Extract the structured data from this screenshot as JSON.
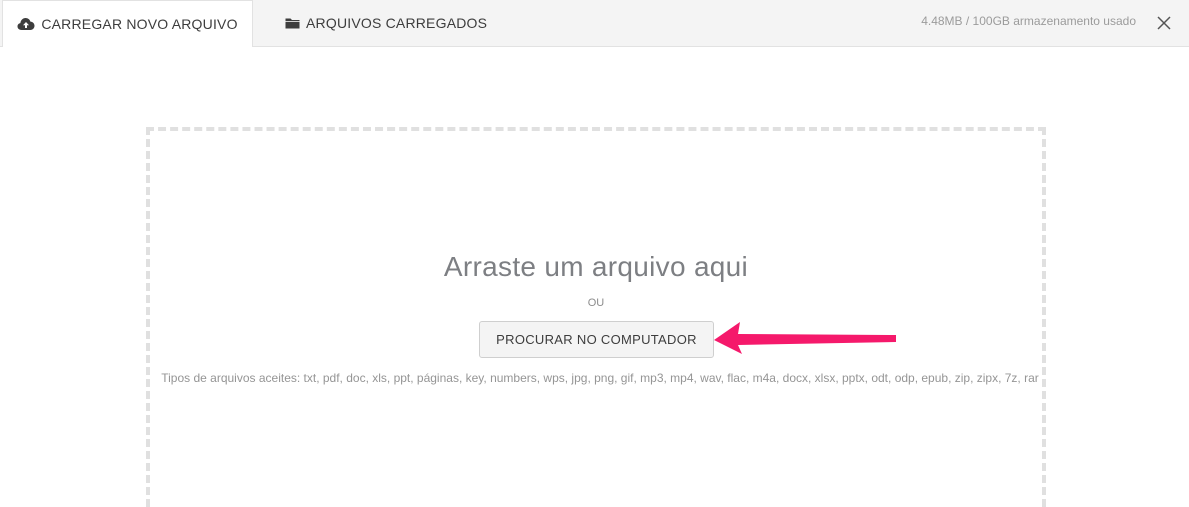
{
  "tabs": [
    {
      "label": "CARREGAR NOVO ARQUIVO",
      "icon": "cloud-upload-icon",
      "active": true
    },
    {
      "label": "ARQUIVOS CARREGADOS",
      "icon": "folder-icon",
      "active": false
    }
  ],
  "storage_text": "4.48MB / 100GB armazenamento usado",
  "close_icon": "close-icon",
  "dropzone": {
    "title": "Arraste um arquivo aqui",
    "or_text": "OU",
    "browse_label": "PROCURAR NO COMPUTADOR",
    "types_text": "Tipos de arquivos aceites: txt, pdf, doc, xls, ppt, páginas, key, numbers, wps, jpg, png, gif, mp3, mp4, wav, flac, m4a, docx, xlsx, pptx, odt, odp, epub, zip, zipx, 7z, rar"
  },
  "colors": {
    "arrow": "#f5196b",
    "dashed_border": "#e0e0e0",
    "topbar_bg": "#f4f4f4"
  }
}
